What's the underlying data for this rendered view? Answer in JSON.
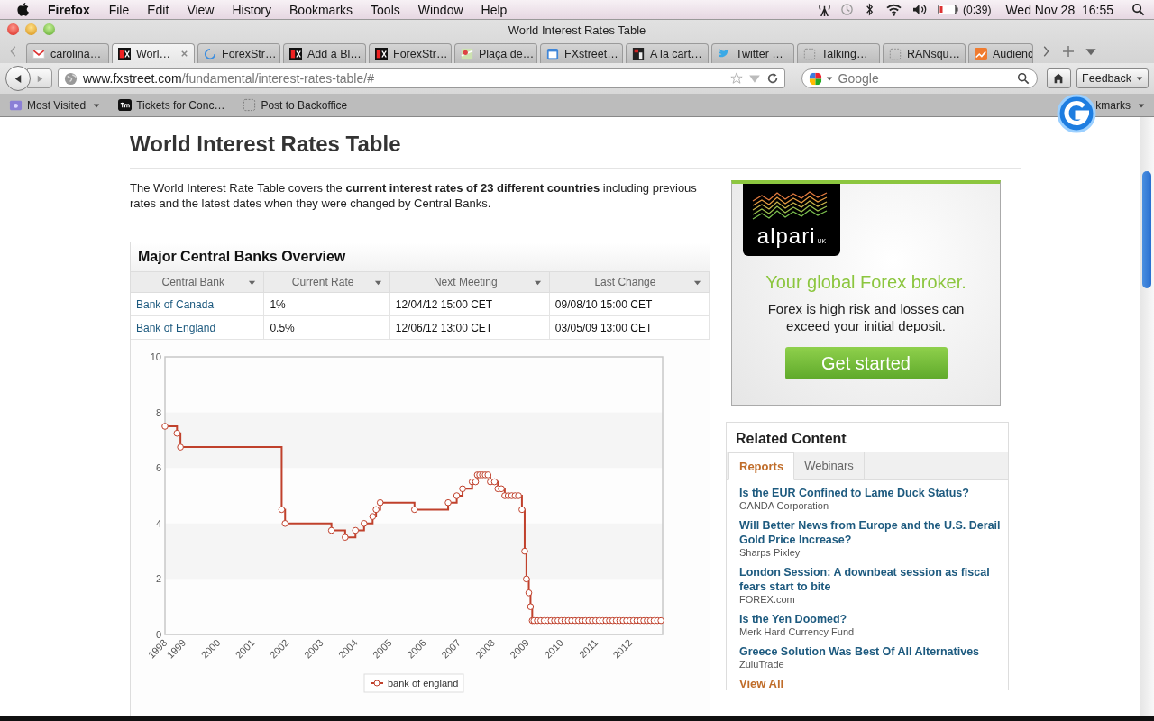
{
  "menu_bar": {
    "app": "Firefox",
    "items": [
      "File",
      "Edit",
      "View",
      "History",
      "Bookmarks",
      "Tools",
      "Window",
      "Help"
    ],
    "battery_time": "(0:39)",
    "clock": "Wed Nov 28  16:55"
  },
  "window": {
    "title": "World Interest Rates Table"
  },
  "tabs": [
    {
      "label": "carolina…",
      "kind": "mail",
      "selected": false
    },
    {
      "label": "Worl…",
      "kind": "fx",
      "selected": true
    },
    {
      "label": "ForexStr…",
      "kind": "loading",
      "selected": false
    },
    {
      "label": "Add a Bl…",
      "kind": "fx",
      "selected": false
    },
    {
      "label": "ForexStr…",
      "kind": "fx",
      "selected": false
    },
    {
      "label": "Plaça de…",
      "kind": "map",
      "selected": false
    },
    {
      "label": "FXstreet…",
      "kind": "calendar",
      "selected": false
    },
    {
      "label": "A la cart…",
      "kind": "radio",
      "selected": false
    },
    {
      "label": "Twitter …",
      "kind": "bird",
      "selected": false
    },
    {
      "label": "Talking…",
      "kind": "blank",
      "selected": false
    },
    {
      "label": "RANsqu…",
      "kind": "blank",
      "selected": false
    },
    {
      "label": "Audienc",
      "kind": "chart",
      "selected": false
    }
  ],
  "nav": {
    "url_host": "www.fxstreet.com",
    "url_path": "/fundamental/interest-rates-table/#",
    "search_placeholder": "Google",
    "feedback": "Feedback"
  },
  "bookmarks": [
    {
      "label": "Most Visited",
      "kind": "folder"
    },
    {
      "label": "Tickets for Conc…",
      "kind": "tm"
    },
    {
      "label": "Post to Backoffice",
      "kind": "blank"
    }
  ],
  "bookmarks_menu": "kmarks",
  "page": {
    "title": "World Interest Rates Table",
    "intro": "The World Interest Rate Table covers the **current interest rates of 23 different countries** including previous rates and the latest dates when they were changed by Central Banks."
  },
  "overview": {
    "title": "Major Central Banks Overview",
    "columns": [
      "Central Bank",
      "Current Rate",
      "Next Meeting",
      "Last Change"
    ],
    "rows": [
      [
        "Bank of Canada",
        "1%",
        "12/04/12 15:00 CET",
        "09/08/10 15:00 CET"
      ],
      [
        "Bank of England",
        "0.5%",
        "12/06/12 13:00 CET",
        "03/05/09 13:00 CET"
      ]
    ],
    "chart_data": {
      "type": "line",
      "xlim": [
        1998.45,
        2012.95
      ],
      "ylim": [
        0,
        10
      ],
      "yticks": [
        0,
        2,
        4,
        6,
        8,
        10
      ],
      "xticks": [
        {
          "value": 1998.45,
          "label": "1998"
        },
        1999,
        2000,
        2001,
        2002,
        2003,
        2004,
        2005,
        2006,
        2007,
        2008,
        2009,
        2010,
        2011,
        2012
      ],
      "x": [
        1998.45,
        1998.8,
        1998.8,
        1998.9,
        1998.9,
        2001.85,
        2001.85,
        2001.95,
        2001.95,
        2003.3,
        2003.3,
        2003.7,
        2003.7,
        2004.0,
        2004.0,
        2004.25,
        2004.25,
        2004.5,
        2004.5,
        2004.6,
        2004.6,
        2004.72,
        2004.72,
        2005.72,
        2005.72,
        2006.7,
        2006.7,
        2006.95,
        2006.95,
        2007.12,
        2007.12,
        2007.4,
        2007.4,
        2007.5,
        2007.55,
        2007.55,
        2007.62,
        2007.7,
        2007.78,
        2007.86,
        2007.93,
        2007.93,
        2008.05,
        2008.15,
        2008.15,
        2008.25,
        2008.35,
        2008.35,
        2008.45,
        2008.55,
        2008.65,
        2008.75,
        2008.85,
        2008.85,
        2008.93,
        2008.93,
        2008.98,
        2008.98,
        2009.05,
        2009.05,
        2009.1,
        2009.1,
        2009.15,
        2009.15,
        2009.2,
        2009.3,
        2009.4,
        2009.5,
        2009.6,
        2009.7,
        2009.8,
        2009.9,
        2010.0,
        2010.1,
        2010.2,
        2010.3,
        2010.4,
        2010.5,
        2010.6,
        2010.7,
        2010.8,
        2010.9,
        2011.0,
        2011.1,
        2011.2,
        2011.3,
        2011.4,
        2011.5,
        2011.6,
        2011.7,
        2011.8,
        2011.9,
        2012.0,
        2012.1,
        2012.2,
        2012.3,
        2012.4,
        2012.5,
        2012.6,
        2012.7,
        2012.8,
        2012.9
      ],
      "series": [
        {
          "name": "bank of england",
          "color": "#c0412c",
          "marker": "circle",
          "values": [
            7.5,
            7.5,
            7.25,
            7.25,
            6.75,
            6.75,
            4.5,
            4.5,
            4.0,
            4.0,
            3.75,
            3.75,
            3.5,
            3.5,
            3.75,
            3.75,
            4.0,
            4.0,
            4.25,
            4.25,
            4.5,
            4.5,
            4.75,
            4.75,
            4.5,
            4.5,
            4.75,
            4.75,
            5.0,
            5.0,
            5.25,
            5.25,
            5.5,
            5.5,
            5.5,
            5.75,
            5.75,
            5.75,
            5.75,
            5.75,
            5.75,
            5.5,
            5.5,
            5.5,
            5.25,
            5.25,
            5.25,
            5.0,
            5.0,
            5.0,
            5.0,
            5.0,
            5.0,
            4.5,
            4.5,
            3.0,
            3.0,
            2.0,
            2.0,
            1.5,
            1.5,
            1.0,
            1.0,
            0.5,
            0.5,
            0.5,
            0.5,
            0.5,
            0.5,
            0.5,
            0.5,
            0.5,
            0.5,
            0.5,
            0.5,
            0.5,
            0.5,
            0.5,
            0.5,
            0.5,
            0.5,
            0.5,
            0.5,
            0.5,
            0.5,
            0.5,
            0.5,
            0.5,
            0.5,
            0.5,
            0.5,
            0.5,
            0.5,
            0.5,
            0.5,
            0.5,
            0.5,
            0.5,
            0.5,
            0.5,
            0.5,
            0.5
          ]
        }
      ]
    }
  },
  "ad": {
    "brand": "alpari",
    "brand_region": "UK",
    "headline": "Your global Forex broker.",
    "warning": "Forex is high risk and losses can exceed your initial deposit.",
    "button": "Get started"
  },
  "related": {
    "title": "Related Content",
    "tabs": [
      {
        "label": "Reports",
        "selected": true
      },
      {
        "label": "Webinars",
        "selected": false
      }
    ],
    "items": [
      {
        "title": "Is the EUR Confined to Lame Duck Status?",
        "source": "OANDA Corporation"
      },
      {
        "title": "Will Better News from Europe and the U.S. Derail Gold Price Increase?",
        "source": "Sharps Pixley"
      },
      {
        "title": "London Session: A downbeat session as fiscal fears start to bite",
        "source": "FOREX.com"
      },
      {
        "title": "Is the Yen Doomed?",
        "source": "Merk Hard Currency Fund"
      },
      {
        "title": "Greece Solution Was Best Of All Alternatives",
        "source": "ZuluTrade"
      }
    ],
    "view_all": "View All"
  }
}
